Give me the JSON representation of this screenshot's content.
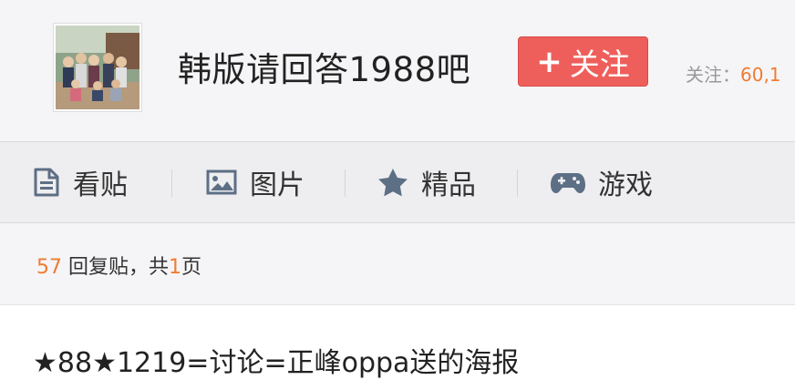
{
  "forum": {
    "title": "韩版请回答1988吧",
    "follow_label": "关注",
    "follow_plus": "+",
    "follow_count_label": "关注：",
    "follow_count_value": "60,1"
  },
  "tabs": [
    {
      "label": "看贴",
      "icon": "document-icon"
    },
    {
      "label": "图片",
      "icon": "image-icon"
    },
    {
      "label": "精品",
      "icon": "star-icon"
    },
    {
      "label": "游戏",
      "icon": "gamepad-icon"
    }
  ],
  "replies": {
    "count": "57",
    "count_text": " 回复贴，共",
    "pages": "1",
    "pages_text": "页"
  },
  "post": {
    "title": "★88★1219=讨论=正峰oppa送的海报"
  },
  "colors": {
    "accent": "#ee5f5b",
    "highlight": "#f07b32",
    "icon": "#5d6f85"
  }
}
